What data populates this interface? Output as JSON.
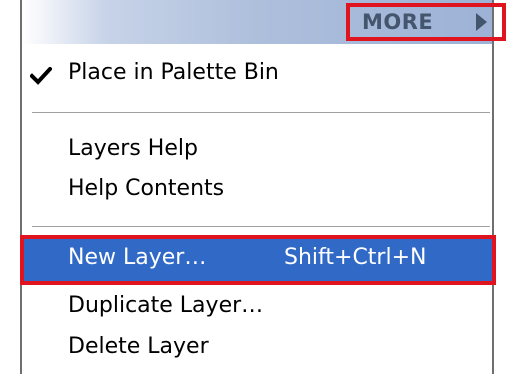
{
  "menu": {
    "more_button": {
      "label": "MORE",
      "arrow_icon": "triangle-right-icon"
    },
    "items": [
      {
        "label": "Place in Palette Bin",
        "checked": true,
        "check_icon": "checkmark-icon"
      },
      {
        "label": "Layers Help"
      },
      {
        "label": "Help Contents"
      },
      {
        "label": "New Layer…",
        "shortcut": "Shift+Ctrl+N",
        "highlighted": true
      },
      {
        "label": "Duplicate Layer…"
      },
      {
        "label": "Delete Layer"
      }
    ]
  },
  "colors": {
    "highlight_background": "#3169c6",
    "annotation_border": "#e0141e",
    "titlebar_gradient_end": "#9db2d6",
    "more_text": "#44556e"
  }
}
